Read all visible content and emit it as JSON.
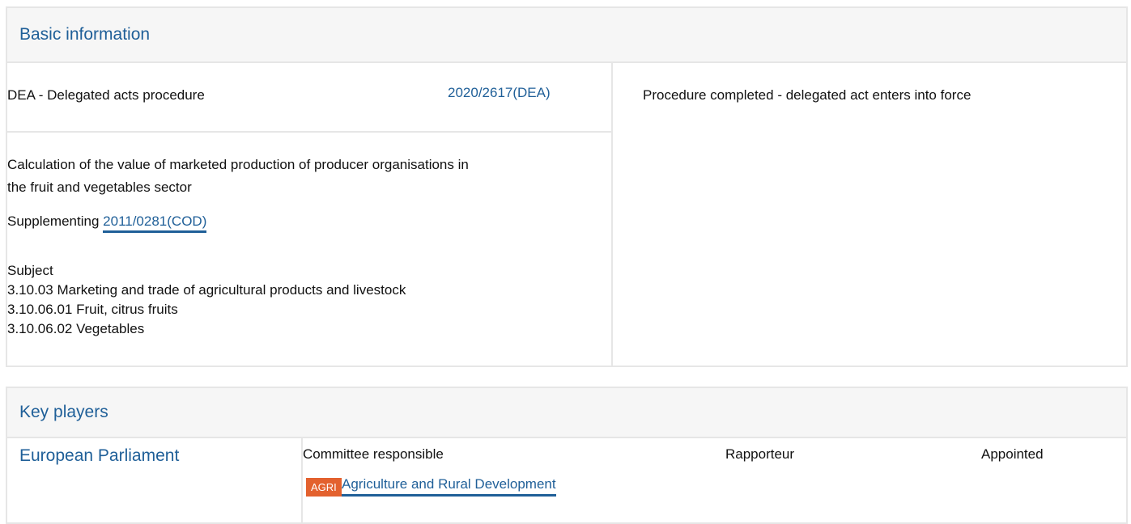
{
  "basic_information": {
    "heading": "Basic information",
    "procedure_type": "DEA - Delegated acts procedure",
    "procedure_ref": "2020/2617(DEA)",
    "status": "Procedure completed - delegated act enters into force",
    "title_line1": "Calculation of the value of marketed production of producer organisations in",
    "title_line2": "the fruit and vegetables sector",
    "supplementing_label": "Supplementing",
    "supplementing_ref": "2011/0281(COD)",
    "subject_label": "Subject",
    "subjects": [
      "3.10.03 Marketing and trade of agricultural products and livestock",
      "3.10.06.01 Fruit, citrus fruits",
      "3.10.06.02 Vegetables"
    ]
  },
  "key_players": {
    "heading": "Key players",
    "institution": "European Parliament",
    "columns": [
      "Committee responsible",
      "Rapporteur",
      "Appointed"
    ],
    "committee_code": "AGRI",
    "committee_name": "Agriculture and Rural Development"
  },
  "colors": {
    "link": "#1f5f98",
    "badge": "#e3612e",
    "header_bg": "#f6f6f6",
    "border": "#e6e6e6"
  }
}
